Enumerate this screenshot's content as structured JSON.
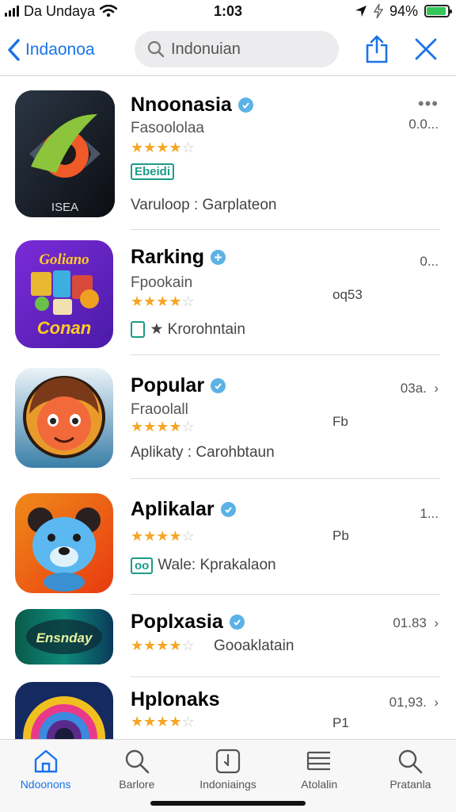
{
  "status_bar": {
    "carrier": "Da Undaya",
    "time": "1:03",
    "battery_text": "94%",
    "battery_level": 0.94,
    "battery_color": "#35c759"
  },
  "nav": {
    "back_label": "Indaonoa",
    "search_placeholder": "Indonuian",
    "accent_color": "#1a73e8"
  },
  "apps": [
    {
      "name": "Nnoonasia",
      "subtitle": "Fasoololaa",
      "rating": 4,
      "tag": "Ebeidi",
      "meta": "Varuloop : Garplateon",
      "price": "0.0...",
      "extra": "",
      "more": "•••"
    },
    {
      "name": "Rarking",
      "subtitle": "Fpookain",
      "rating": 4,
      "tag": "",
      "meta": "★ Krorohntain",
      "price": "0...",
      "extra": "oq53",
      "more": ""
    },
    {
      "name": "Popular",
      "subtitle": "Fraoolall",
      "rating": 4,
      "tag": "",
      "meta": "Aplikaty : Carohbtaun",
      "price": "03a.",
      "extra": "Fb",
      "more": ""
    },
    {
      "name": "Aplikalar",
      "subtitle": "",
      "rating": 4,
      "tag": "oo",
      "meta": "Wale: Kprakalaon",
      "price": "1...",
      "extra": "Pb",
      "more": ""
    },
    {
      "name": "Poplxasia",
      "subtitle": "",
      "rating": 4,
      "tag": "",
      "meta": "Gooaklatain",
      "price": "01.83",
      "extra": "",
      "more": ""
    },
    {
      "name": "Hplonaks",
      "subtitle": "",
      "rating": 4,
      "tag": "",
      "meta": "",
      "price": "01,93.",
      "extra": "P1",
      "more": ""
    }
  ],
  "icon_texts": {
    "app1_caption": "ISEA",
    "app2_top": "Goliano",
    "app2_bottom": "Conan",
    "app5_text": "Ensnday"
  },
  "tabs": [
    {
      "label": "Ndoonons",
      "icon": "home-icon",
      "active": true
    },
    {
      "label": "Barlore",
      "icon": "search-icon",
      "active": false
    },
    {
      "label": "Indoniaings",
      "icon": "updates-icon",
      "active": false
    },
    {
      "label": "Atolalin",
      "icon": "list-icon",
      "active": false
    },
    {
      "label": "Pratanla",
      "icon": "search-icon",
      "active": false
    }
  ]
}
